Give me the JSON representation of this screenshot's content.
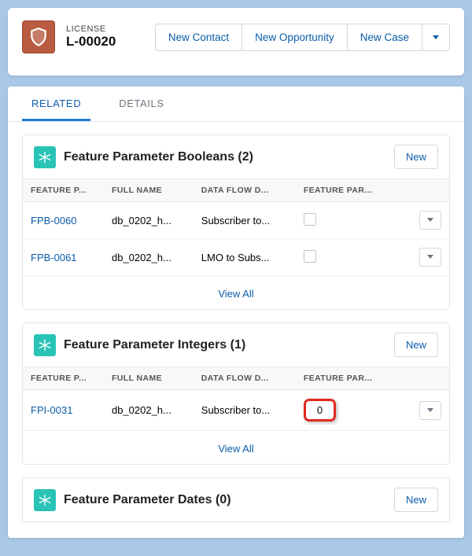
{
  "record": {
    "type_label": "LICENSE",
    "name": "L-00020"
  },
  "header_actions": {
    "new_contact": "New Contact",
    "new_opportunity": "New Opportunity",
    "new_case": "New Case"
  },
  "tabs": {
    "related": "RELATED",
    "details": "DETAILS"
  },
  "common": {
    "new_btn": "New",
    "view_all": "View All"
  },
  "cols": {
    "param": "FEATURE P...",
    "full_name": "FULL NAME",
    "data_flow": "DATA FLOW D...",
    "value": "FEATURE PAR..."
  },
  "booleans": {
    "title": "Feature Parameter Booleans (2)",
    "rows": [
      {
        "param": "FPB-0060",
        "full_name": "db_0202_h...",
        "data_flow": "Subscriber to...",
        "value": ""
      },
      {
        "param": "FPB-0061",
        "full_name": "db_0202_h...",
        "data_flow": "LMO to Subs...",
        "value": ""
      }
    ]
  },
  "integers": {
    "title": "Feature Parameter Integers (1)",
    "rows": [
      {
        "param": "FPI-0031",
        "full_name": "db_0202_h...",
        "data_flow": "Subscriber to...",
        "value": "0"
      }
    ]
  },
  "dates": {
    "title": "Feature Parameter Dates (0)"
  }
}
